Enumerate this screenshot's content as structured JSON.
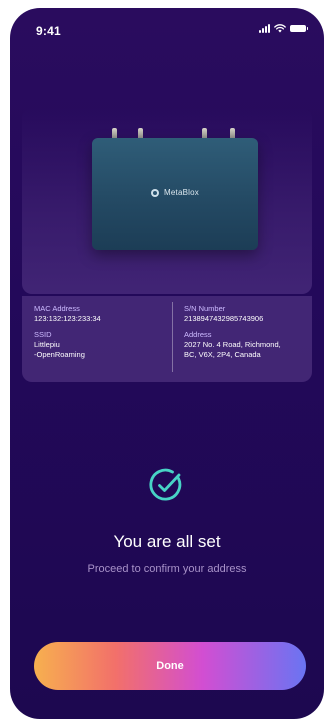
{
  "status_bar": {
    "time": "9:41",
    "icons": [
      "signal-icon",
      "wifi-icon",
      "battery-icon"
    ]
  },
  "device": {
    "brand": "MetaBlox",
    "image": "router-device"
  },
  "info": {
    "mac_label": "MAC Address",
    "mac_value": "123:132:123:233:34",
    "ssid_label": "SSID",
    "ssid_value_line1": "Littlepiu",
    "ssid_value_line2": "-OpenRoaming",
    "sn_label": "S/N Number",
    "sn_value": "2138947432985743906",
    "address_label": "Address",
    "address_line1": "2027 No. 4 Road, Richmond,",
    "address_line2": "BC, V6X, 2P4, Canada"
  },
  "success": {
    "icon": "check-circle-icon",
    "title": "You are all set",
    "subtitle": "Proceed to confirm your address"
  },
  "actions": {
    "done_label": "Done"
  },
  "colors": {
    "background": "#24095a",
    "accent_teal": "#48d3c6",
    "button_gradient": [
      "#f7b04f",
      "#f2706a",
      "#d24ed2",
      "#6a74f2"
    ]
  }
}
